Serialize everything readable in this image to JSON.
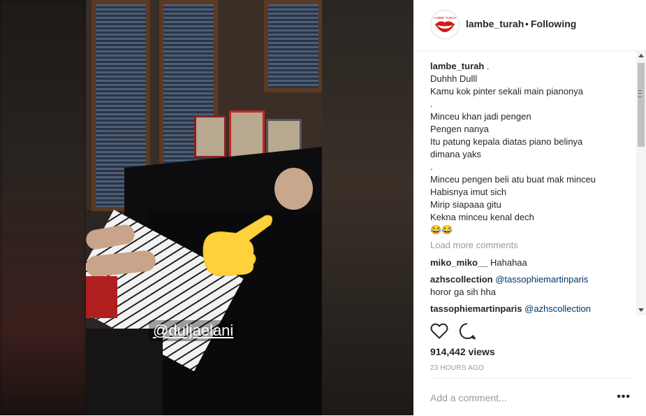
{
  "media": {
    "sticker_mention": "@duljaelani"
  },
  "header": {
    "username": "lambe_turah",
    "separator": "•",
    "follow_status": "Following",
    "avatar_brand": "LAMBE TURAH"
  },
  "caption": {
    "username": "lambe_turah",
    "lines": [
      " .",
      "Duhhh Dulll",
      "Kamu kok pinter sekali main pianonya",
      ".",
      "Minceu khan jadi pengen",
      "Pengen nanya",
      "Itu patung kepala diatas piano belinya",
      "dimana yaks",
      ".",
      "Minceu pengen beli atu buat mak minceu",
      "Habisnya imut sich",
      "Mirip siapaaa gitu",
      "Kekna minceu kenal dech",
      "😂😂"
    ]
  },
  "load_more": "Load more comments",
  "comments": [
    {
      "username": "miko_miko__",
      "mention": "",
      "text": "Hahahaa"
    },
    {
      "username": "azhscollection",
      "mention": "@tassophiemartinparis",
      "text": "horor ga sih hha"
    },
    {
      "username": "tassophiemartinparis",
      "mention": "@azhscollection",
      "text": ""
    }
  ],
  "stats": {
    "views": "914,442 views",
    "time_ago": "23 HOURS AGO"
  },
  "add_comment": {
    "placeholder": "Add a comment...",
    "more": "•••"
  },
  "icons": {
    "like": "heart-icon",
    "comment": "comment-bubble-icon",
    "more": "more-options-icon"
  },
  "colors": {
    "text": "#262626",
    "muted": "#999999",
    "link": "#003569",
    "border": "#efefef"
  }
}
